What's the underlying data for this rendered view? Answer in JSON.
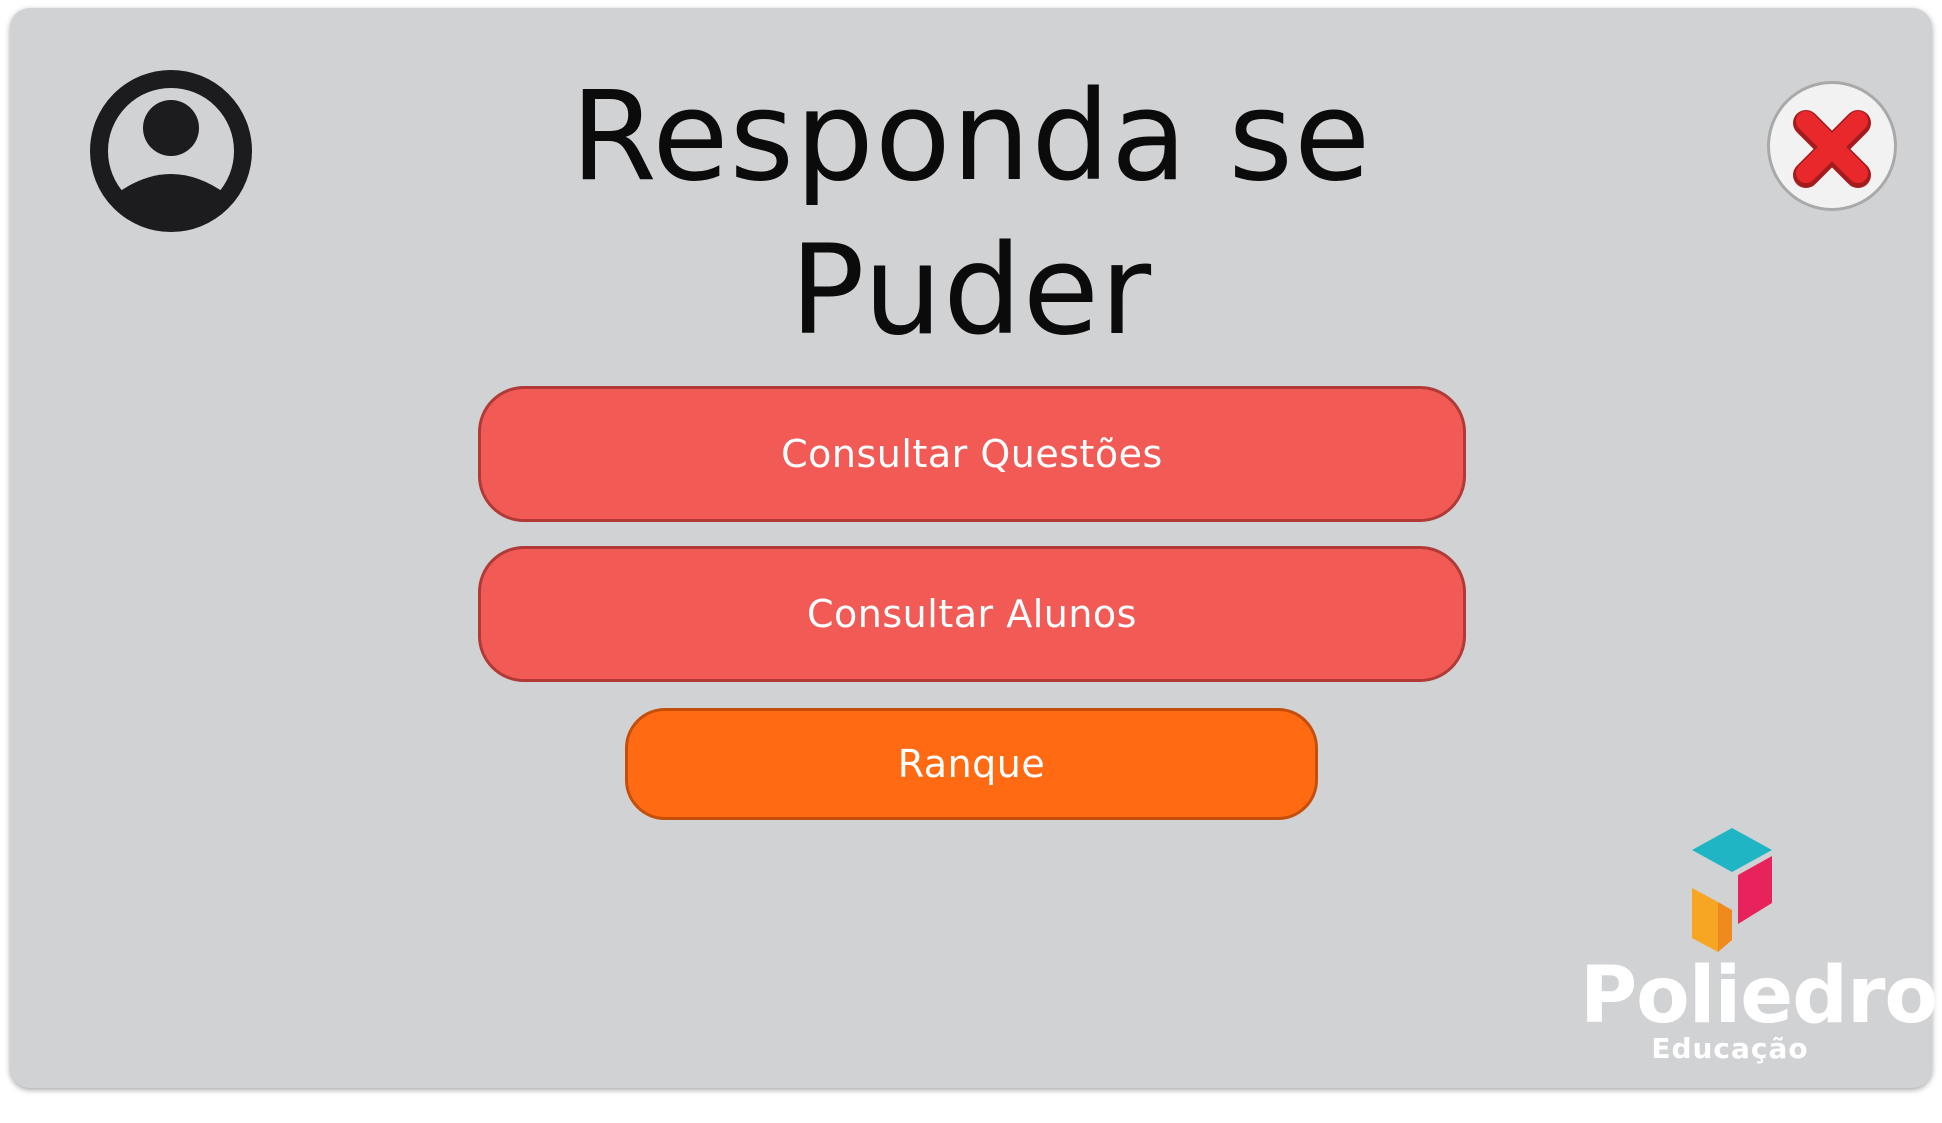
{
  "header": {
    "title_line1": "Responda se",
    "title_line2": "Puder"
  },
  "icons": {
    "profile": "user-circle-icon",
    "close": "close-x-icon"
  },
  "menu": {
    "questions_label": "Consultar Questões",
    "students_label": "Consultar Alunos",
    "ranking_label": "Ranque"
  },
  "brand": {
    "name": "Poliedro",
    "tagline": "Educação"
  },
  "colors": {
    "background": "#d1d2d4",
    "primary_button": "#f25a56",
    "ranking_button": "#ff6a13",
    "close_icon": "#e8282b"
  }
}
